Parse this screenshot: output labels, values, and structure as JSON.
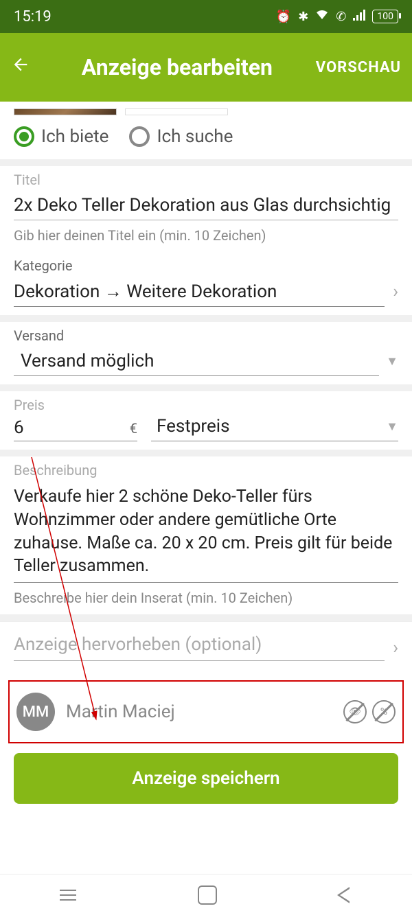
{
  "status": {
    "time": "15:19",
    "battery": "100"
  },
  "appbar": {
    "title": "Anzeige bearbeiten",
    "preview": "VORSCHAU"
  },
  "offer_type": {
    "offer": "Ich biete",
    "search": "Ich suche"
  },
  "title": {
    "label": "Titel",
    "value": "2x Deko Teller Dekoration aus Glas durchsichtig",
    "hint": "Gib hier deinen Titel ein (min. 10 Zeichen)"
  },
  "category": {
    "label": "Kategorie",
    "value": "Dekoration → Weitere Dekoration"
  },
  "shipping": {
    "label": "Versand",
    "value": "Versand möglich"
  },
  "price": {
    "label": "Preis",
    "value": "6",
    "currency": "€",
    "type": "Festpreis"
  },
  "description": {
    "label": "Beschreibung",
    "value": "Verkaufe hier 2 schöne Deko-Teller fürs Wohnzimmer oder andere gemütliche Orte zuhause. Maße ca. 20 x 20 cm. Preis gilt für beide Teller zusammen.",
    "hint": "Beschreibe hier dein Inserat (min. 10 Zeichen)"
  },
  "highlight": {
    "label": "Anzeige hervorheben (optional)"
  },
  "user": {
    "initials": "MM",
    "name": "Martin Maciej"
  },
  "save": {
    "label": "Anzeige speichern"
  }
}
